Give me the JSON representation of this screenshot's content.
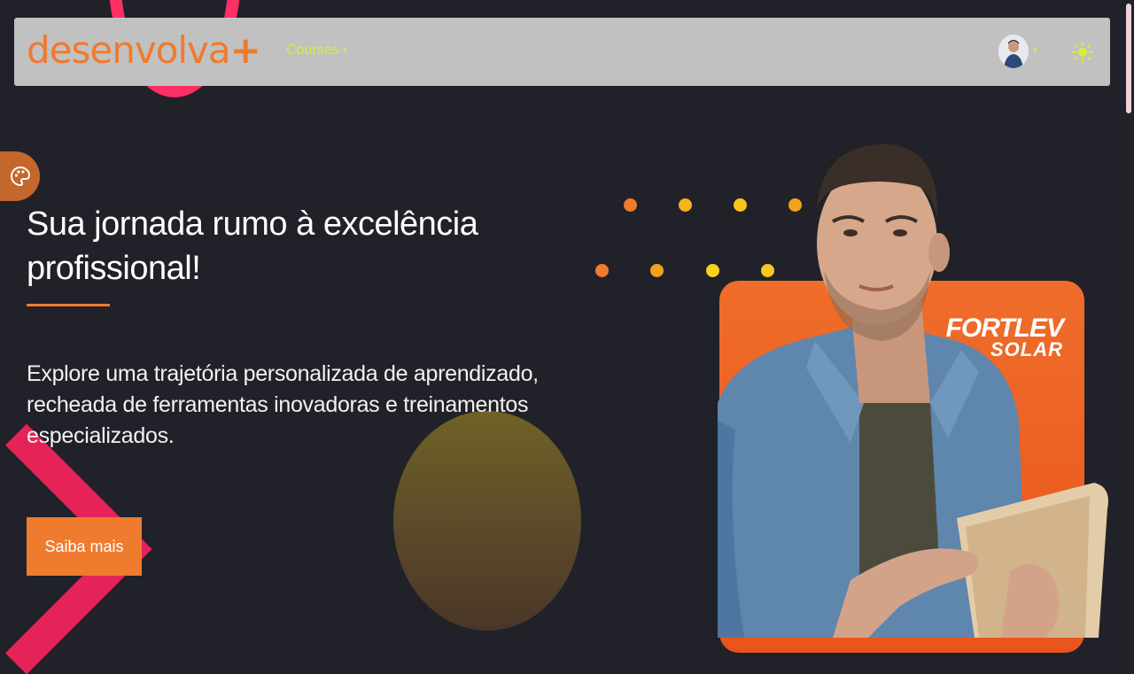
{
  "navbar": {
    "logo_text": "desenvolva",
    "logo_plus": "+",
    "courses_label": "Courses",
    "chevron": "⌄"
  },
  "hero": {
    "title": "Sua jornada rumo à excelência profissional!",
    "subtitle": "Explore uma trajetória personalizada de aprendizado, recheada de ferramentas inovadoras e treinamentos especializados.",
    "cta_label": "Saiba mais"
  },
  "brand": {
    "line1": "FORTLEV",
    "line2": "SOLAR"
  },
  "icons": {
    "theme_toggle": "sun-icon",
    "palette": "palette-icon",
    "user": "avatar"
  },
  "colors": {
    "accent": "#ef7b2e",
    "nav_link": "#d8ec3c",
    "background": "#212129",
    "navbar_bg": "#c1c1c1",
    "deco_pink": "#ff2e63"
  }
}
